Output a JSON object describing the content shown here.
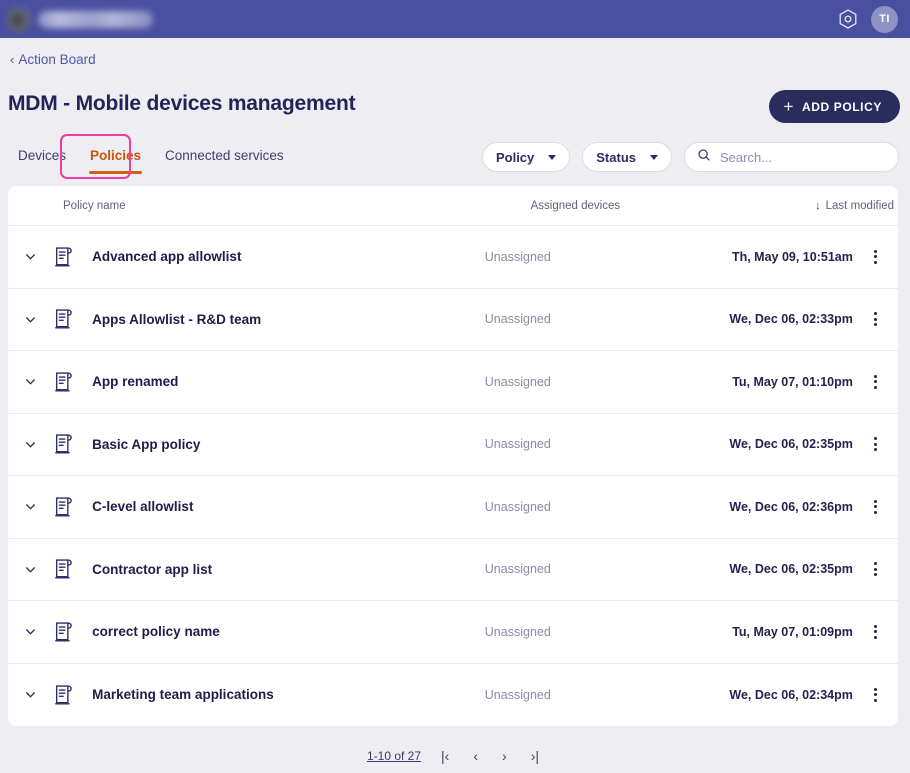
{
  "appbar": {
    "logo_icon": "brand-logo-blurred",
    "brand_text_redacted": "",
    "settings_icon": "gear-hexagon-icon",
    "avatar_initials": "TI",
    "background_color": "#4a50a0"
  },
  "breadcrumb": {
    "chevron": "‹",
    "label": "Action Board"
  },
  "header": {
    "title": "MDM - Mobile devices management",
    "add_button": {
      "plus": "+",
      "label": "ADD POLICY"
    }
  },
  "tabs": {
    "items": [
      {
        "label": "Devices",
        "active": false
      },
      {
        "label": "Policies",
        "active": true
      },
      {
        "label": "Connected services",
        "active": false
      }
    ],
    "active_color": "#d2600f",
    "highlight_color": "#ef3ba2"
  },
  "filters": {
    "policy_dropdown": {
      "label": "Policy"
    },
    "status_dropdown": {
      "label": "Status"
    },
    "search": {
      "icon": "search-icon",
      "placeholder": "Search...",
      "value": ""
    }
  },
  "table": {
    "columns": {
      "name": "Policy name",
      "assigned": "Assigned devices",
      "modified": "Last modified",
      "sort_arrow": "↓"
    },
    "rows": [
      {
        "icon": "policy-document-icon",
        "name": "Advanced app allowlist",
        "assigned": "Unassigned",
        "modified": "Th, May 09, 10:51am"
      },
      {
        "icon": "policy-document-icon",
        "name": "Apps Allowlist - R&D team",
        "assigned": "Unassigned",
        "modified": "We, Dec 06, 02:33pm"
      },
      {
        "icon": "policy-document-icon",
        "name": "App renamed",
        "assigned": "Unassigned",
        "modified": "Tu, May 07, 01:10pm"
      },
      {
        "icon": "policy-document-icon",
        "name": "Basic App policy",
        "assigned": "Unassigned",
        "modified": "We, Dec 06, 02:35pm"
      },
      {
        "icon": "policy-document-icon",
        "name": "C-level allowlist",
        "assigned": "Unassigned",
        "modified": "We, Dec 06, 02:36pm"
      },
      {
        "icon": "policy-document-icon",
        "name": "Contractor app list",
        "assigned": "Unassigned",
        "modified": "We, Dec 06, 02:35pm"
      },
      {
        "icon": "policy-document-icon",
        "name": "correct policy name",
        "assigned": "Unassigned",
        "modified": "Tu, May 07, 01:09pm"
      },
      {
        "icon": "policy-document-icon",
        "name": "Marketing team applications",
        "assigned": "Unassigned",
        "modified": "We, Dec 06, 02:34pm"
      }
    ]
  },
  "pagination": {
    "range": "1-10 of 27",
    "first": "|‹",
    "prev": "‹",
    "next": "›",
    "last": "›|"
  }
}
